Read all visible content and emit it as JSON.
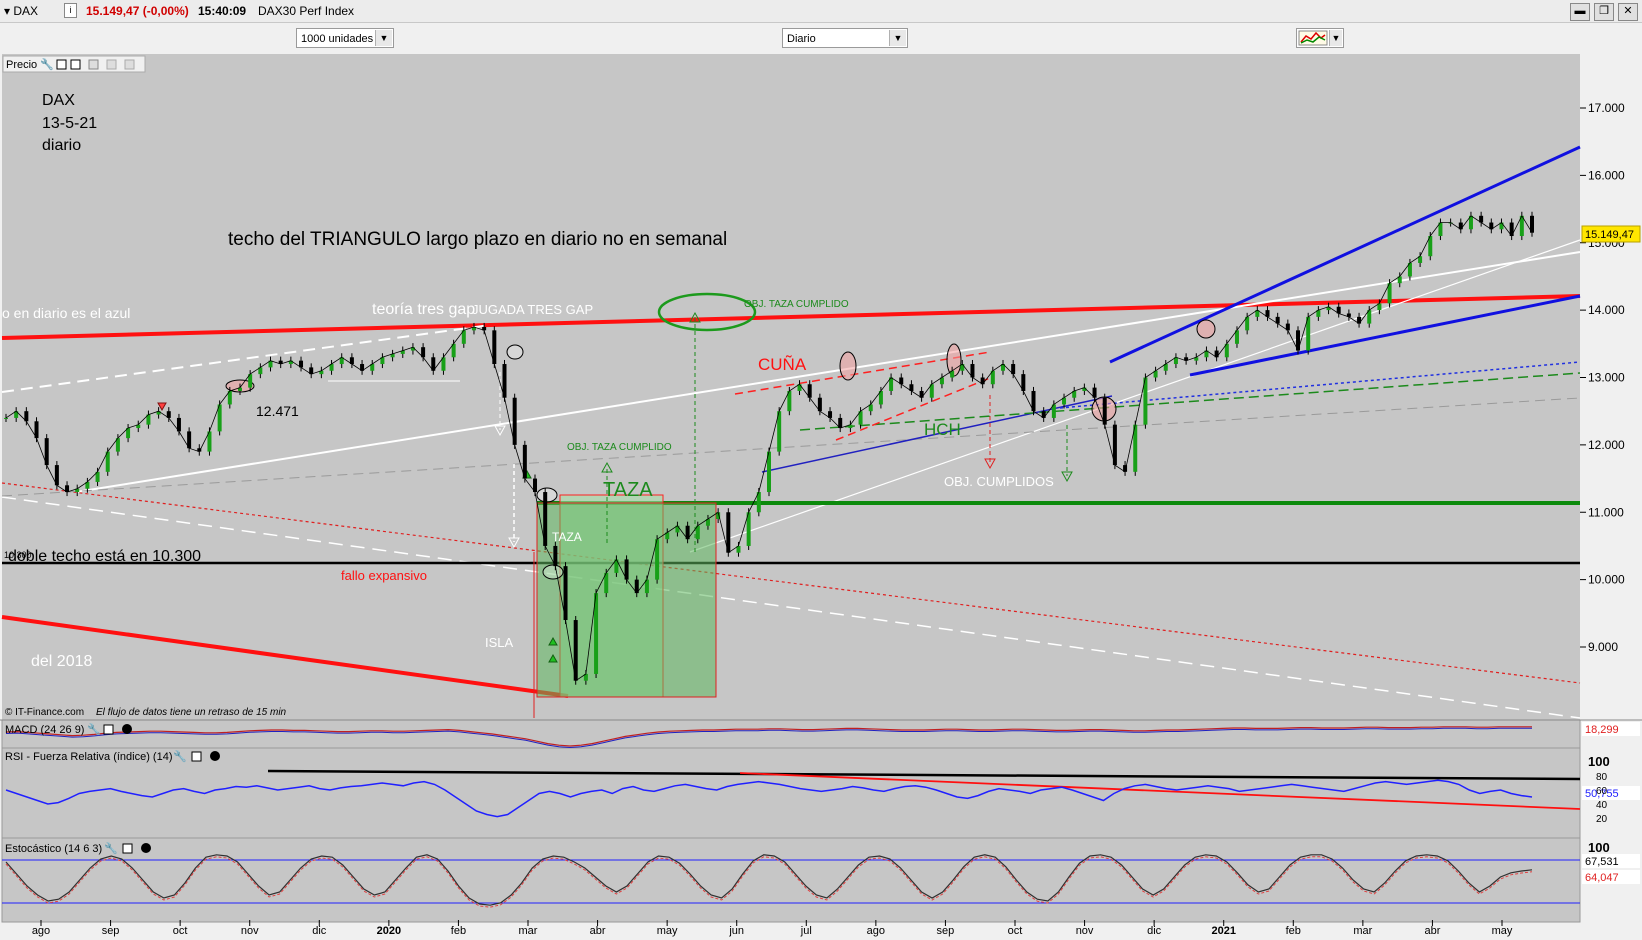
{
  "window": {
    "symbol": "DAX",
    "price_change": "15.149,47 (-0,00%)",
    "time": "15:40:09",
    "index_name": "DAX30 Perf Index"
  },
  "controls": {
    "units": "1000 unidades",
    "period": "Diario"
  },
  "panels": {
    "price_label": "Precio",
    "macd_label": "MACD (24 26 9)",
    "macd_value": "18,299",
    "rsi_label": "RSI - Fuerza Relativa (índice) (14)",
    "rsi_value": "50,755",
    "stoch_label": "Estocástico (14 6 3)",
    "stoch_value1": "67,531",
    "stoch_value2": "64,047",
    "copyright": "© IT-Finance.com",
    "delay_note": "El flujo de datos tiene un retraso de 15 min"
  },
  "chart_data": {
    "type": "line",
    "title": "DAX",
    "ylim": [
      8200,
      17600
    ],
    "y_ticks": [
      "17.000",
      "16.000",
      "15.000",
      "14.000",
      "13.000",
      "12.000",
      "11.000",
      "10.000",
      "9.000"
    ],
    "current_price_label": "15.149,47",
    "months": [
      "ago",
      "sep",
      "oct",
      "nov",
      "dic",
      "2020",
      "feb",
      "mar",
      "abr",
      "may",
      "jun",
      "jul",
      "ago",
      "sep",
      "oct",
      "nov",
      "dic",
      "2021",
      "feb",
      "mar",
      "abr",
      "may"
    ],
    "month_bold": [
      "2020",
      "2021"
    ],
    "rsi_ticks": [
      "100",
      "80",
      "60",
      "40",
      "20"
    ],
    "stoch_ticks": [
      "100"
    ],
    "series": [
      {
        "values": [
          12400,
          12500,
          12350,
          12100,
          11700,
          11400,
          11300,
          11350,
          11450,
          11600,
          11900,
          12100,
          12250,
          12300,
          12450,
          12500,
          12400,
          12200,
          11950,
          11900,
          12200,
          12600,
          12800,
          12850,
          13050,
          13150,
          13250,
          13200,
          13250,
          13150,
          13050,
          13100,
          13200,
          13300,
          13200,
          13100,
          13200,
          13300,
          13350,
          13400,
          13450,
          13300,
          13100,
          13300,
          13500,
          13700,
          13750,
          13700,
          13200,
          12700,
          12000,
          11500,
          11300,
          10500,
          10200,
          9400,
          8500,
          8600,
          9800,
          10100,
          10300,
          10000,
          9800,
          10000,
          10600,
          10700,
          10800,
          10600,
          10800,
          10900,
          11000,
          10400,
          10500,
          11000,
          11300,
          11900,
          12500,
          12800,
          12900,
          12700,
          12500,
          12400,
          12250,
          12300,
          12500,
          12600,
          12800,
          13000,
          12900,
          12800,
          12700,
          12900,
          13000,
          13100,
          13200,
          13000,
          12900,
          13100,
          13200,
          13050,
          12800,
          12500,
          12400,
          12600,
          12700,
          12800,
          12850,
          12700,
          12300,
          11700,
          11600,
          12300,
          13000,
          13100,
          13200,
          13300,
          13250,
          13300,
          13400,
          13300,
          13500,
          13700,
          13900,
          14000,
          13900,
          13800,
          13700,
          13400,
          13900,
          14000,
          14050,
          13950,
          13900,
          13800,
          14000,
          14100,
          14400,
          14500,
          14700,
          14800,
          15100,
          15300,
          15300,
          15200,
          15400,
          15300,
          15200,
          15300,
          15100,
          15400,
          15149
        ]
      }
    ],
    "macd_values": [
      5,
      6,
      4,
      2,
      0,
      -2,
      -4,
      -3,
      -1,
      2,
      4,
      5,
      6,
      7,
      7,
      6,
      5,
      4,
      3,
      3,
      4,
      6,
      8,
      9,
      10,
      10,
      9,
      9,
      8,
      7,
      6,
      6,
      7,
      8,
      8,
      7,
      7,
      8,
      9,
      10,
      11,
      9,
      6,
      3,
      0,
      -4,
      -8,
      -12,
      -18,
      -24,
      -28,
      -30,
      -28,
      -24,
      -18,
      -12,
      -6,
      -2,
      2,
      5,
      7,
      8,
      9,
      10,
      10,
      11,
      12,
      12,
      12,
      13,
      13,
      12,
      11,
      11,
      12,
      13,
      14,
      14,
      13,
      12,
      11,
      10,
      10,
      10,
      11,
      12,
      12,
      11,
      10,
      10,
      11,
      12,
      12,
      11,
      10,
      9,
      9,
      10,
      11,
      11,
      10,
      9,
      8,
      8,
      9,
      10,
      10,
      11,
      12,
      13,
      14,
      15,
      15,
      14,
      14,
      14,
      15,
      16,
      16,
      15,
      15,
      15,
      16,
      17,
      17,
      16,
      16,
      16,
      17,
      17,
      18,
      18,
      18,
      17,
      17,
      18,
      18,
      18,
      18
    ],
    "rsi_values": [
      60,
      55,
      50,
      45,
      40,
      42,
      48,
      55,
      58,
      60,
      62,
      58,
      55,
      52,
      50,
      55,
      60,
      62,
      58,
      55,
      60,
      62,
      65,
      64,
      66,
      63,
      60,
      62,
      64,
      66,
      62,
      60,
      63,
      65,
      66,
      68,
      70,
      68,
      66,
      70,
      72,
      68,
      60,
      50,
      40,
      30,
      25,
      22,
      25,
      35,
      45,
      55,
      58,
      55,
      50,
      55,
      58,
      60,
      55,
      62,
      65,
      60,
      58,
      62,
      66,
      68,
      65,
      62,
      60,
      65,
      68,
      70,
      72,
      70,
      68,
      65,
      62,
      60,
      58,
      60,
      62,
      65,
      63,
      60,
      58,
      62,
      65,
      66,
      64,
      60,
      55,
      50,
      48,
      52,
      58,
      62,
      60,
      58,
      55,
      60,
      62,
      64,
      60,
      55,
      50,
      45,
      55,
      62,
      66,
      68,
      65,
      62,
      60,
      62,
      64,
      66,
      64,
      62,
      58,
      60,
      62,
      64,
      66,
      68,
      66,
      64,
      62,
      60,
      58,
      62,
      66,
      70,
      72,
      70,
      68,
      70,
      72,
      74,
      72,
      68,
      60,
      55,
      58,
      60,
      55,
      52,
      50
    ],
    "stoch_values": [
      80,
      60,
      40,
      25,
      15,
      18,
      30,
      50,
      70,
      85,
      90,
      85,
      70,
      50,
      30,
      20,
      25,
      45,
      70,
      88,
      92,
      90,
      80,
      60,
      40,
      25,
      30,
      50,
      70,
      85,
      90,
      88,
      75,
      55,
      35,
      25,
      30,
      50,
      70,
      88,
      92,
      85,
      65,
      40,
      20,
      10,
      8,
      12,
      25,
      45,
      70,
      85,
      90,
      88,
      80,
      70,
      55,
      40,
      30,
      40,
      60,
      80,
      90,
      88,
      78,
      60,
      40,
      25,
      20,
      35,
      60,
      82,
      92,
      90,
      80,
      60,
      40,
      25,
      20,
      35,
      55,
      75,
      88,
      90,
      85,
      70,
      50,
      30,
      20,
      30,
      50,
      72,
      88,
      92,
      88,
      72,
      50,
      30,
      18,
      15,
      30,
      55,
      78,
      90,
      92,
      88,
      75,
      55,
      35,
      25,
      35,
      55,
      75,
      88,
      92,
      90,
      80,
      62,
      42,
      30,
      35,
      55,
      75,
      88,
      92,
      92,
      85,
      70,
      50,
      35,
      30,
      45,
      65,
      82,
      90,
      92,
      90,
      82,
      65,
      45,
      30,
      40,
      55,
      62,
      65,
      67
    ]
  },
  "annotations": {
    "dax_title": "DAX",
    "date": "13-5-21",
    "period": "diario",
    "triangle_note": "techo del TRIANGULO largo plazo en diario no en semanal",
    "blue_note": "o en diario es el azul",
    "three_gap": "teoría tres gap",
    "three_gap_done": "JUGADA TRES GAP",
    "taza_done_1": "OBJ. TAZA CUMPLIDO",
    "taza_done_2": "OBJ. TAZA CUMPLIDO",
    "cuna": "CUÑA",
    "hch": "HCH",
    "obj_cumplidos": "OBJ. CUMPLIDOS",
    "taza_big": "TAZA",
    "taza_small": "TAZA",
    "level_12471": "12.471",
    "double_top": "doble techo está en 10.300",
    "level_small": "10.300",
    "fallo": "fallo expansivo",
    "isla": "ISLA",
    "del2018": "del 2018"
  }
}
